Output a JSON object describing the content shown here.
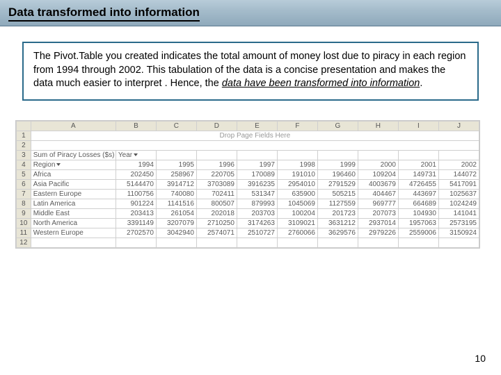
{
  "title": "Data transformed into information",
  "callout": {
    "line1": "The Pivot.Table you created indicates the total amount of money lost due to piracy in each region from 1994 through 2002.  This tabulation of the data is a concise presentation and makes the data much easier to interpret .  Hence, the ",
    "line2_underlined": "data have been transformed into information",
    "line3_period": "."
  },
  "page_number": "10",
  "pivot": {
    "columns": [
      "A",
      "B",
      "C",
      "D",
      "E",
      "F",
      "G",
      "H",
      "I",
      "J"
    ],
    "page_fields_text": "Drop Page Fields Here",
    "row3_label": "Sum of Piracy Losses ($s)",
    "row3_year": "Year",
    "row4_region": "Region",
    "years": [
      "1994",
      "1995",
      "1996",
      "1997",
      "1998",
      "1999",
      "2000",
      "2001",
      "2002"
    ],
    "regions": [
      {
        "name": "Africa",
        "vals": [
          "202450",
          "258967",
          "220705",
          "170089",
          "191010",
          "196460",
          "109204",
          "149731",
          "144072"
        ]
      },
      {
        "name": "Asia Pacific",
        "vals": [
          "5144470",
          "3914712",
          "3703089",
          "3916235",
          "2954010",
          "2791529",
          "4003679",
          "4726455",
          "5417091"
        ]
      },
      {
        "name": "Eastern Europe",
        "vals": [
          "1100756",
          "740080",
          "702411",
          "531347",
          "635900",
          "505215",
          "404467",
          "443697",
          "1025637"
        ]
      },
      {
        "name": "Latin America",
        "vals": [
          "901224",
          "1141516",
          "800507",
          "879993",
          "1045069",
          "1127559",
          "969777",
          "664689",
          "1024249"
        ]
      },
      {
        "name": "Middle East",
        "vals": [
          "203413",
          "261054",
          "202018",
          "203703",
          "100204",
          "201723",
          "207073",
          "104930",
          "141041"
        ]
      },
      {
        "name": "North America",
        "vals": [
          "3391149",
          "3207079",
          "2710250",
          "3174263",
          "3109021",
          "3631212",
          "2937014",
          "1957063",
          "2573195"
        ]
      },
      {
        "name": "Western Europe",
        "vals": [
          "2702570",
          "3042940",
          "2574071",
          "2510727",
          "2760066",
          "3629576",
          "2979226",
          "2559006",
          "3150924"
        ]
      }
    ]
  },
  "chart_data": {
    "type": "table",
    "title": "Sum of Piracy Losses ($s) by Region and Year",
    "xlabel": "Year",
    "ylabel": "Region",
    "categories": [
      "1994",
      "1995",
      "1996",
      "1997",
      "1998",
      "1999",
      "2000",
      "2001",
      "2002"
    ],
    "series": [
      {
        "name": "Africa",
        "values": [
          202450,
          258967,
          220705,
          170089,
          191010,
          196460,
          109204,
          149731,
          144072
        ]
      },
      {
        "name": "Asia Pacific",
        "values": [
          5144470,
          3914712,
          3703089,
          3916235,
          2954010,
          2791529,
          4003679,
          4726455,
          5417091
        ]
      },
      {
        "name": "Eastern Europe",
        "values": [
          1100756,
          740080,
          702411,
          531347,
          635900,
          505215,
          404467,
          443697,
          1025637
        ]
      },
      {
        "name": "Latin America",
        "values": [
          901224,
          1141516,
          800507,
          879993,
          1045069,
          1127559,
          969777,
          664689,
          1024249
        ]
      },
      {
        "name": "Middle East",
        "values": [
          203413,
          261054,
          202018,
          203703,
          100204,
          201723,
          207073,
          104930,
          141041
        ]
      },
      {
        "name": "North America",
        "values": [
          3391149,
          3207079,
          2710250,
          3174263,
          3109021,
          3631212,
          2937014,
          1957063,
          2573195
        ]
      },
      {
        "name": "Western Europe",
        "values": [
          2702570,
          3042940,
          2574071,
          2510727,
          2760066,
          3629576,
          2979226,
          2559006,
          3150924
        ]
      }
    ]
  }
}
